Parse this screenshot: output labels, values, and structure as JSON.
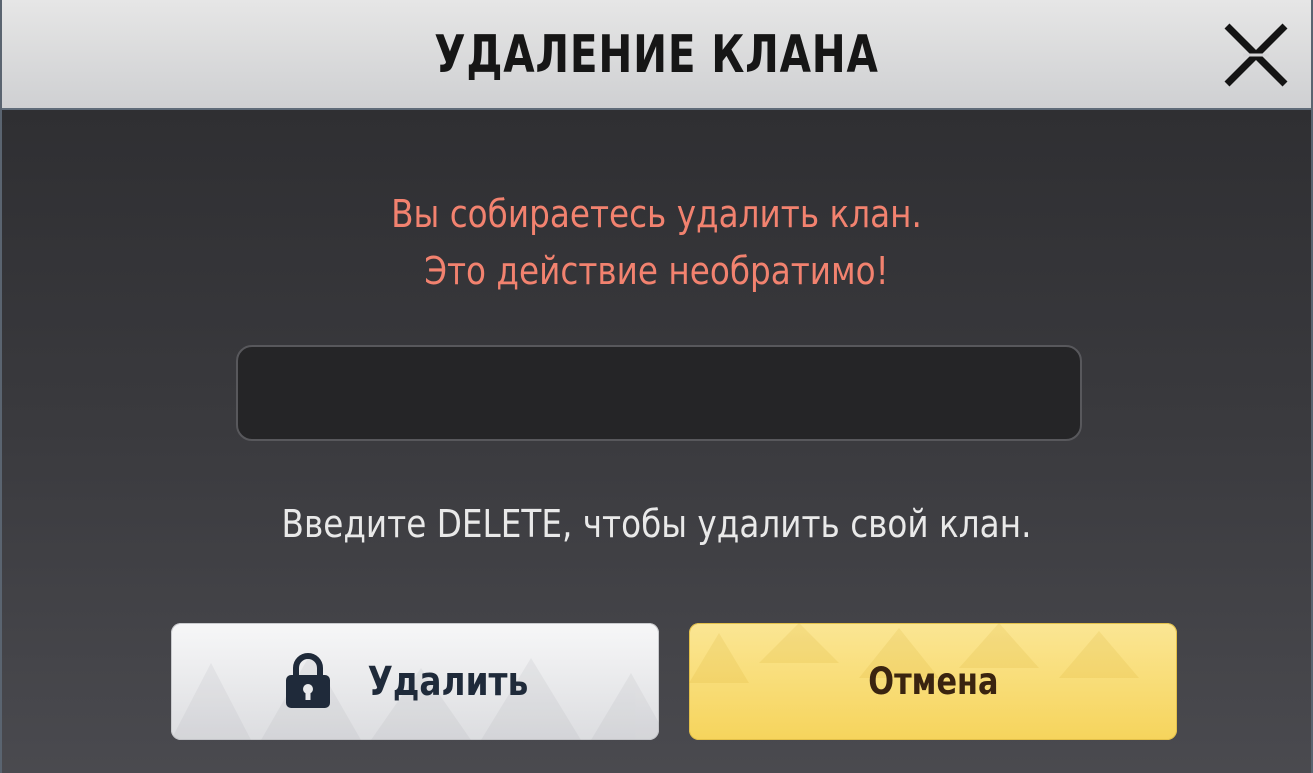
{
  "dialog": {
    "title": "УДАЛЕНИЕ КЛАНА",
    "close_icon": "close-icon",
    "warning_line1": "Вы собираетесь удалить клан.",
    "warning_line2": "Это действие необратимо!",
    "input": {
      "value": "",
      "placeholder": ""
    },
    "hint": "Введите DELETE, чтобы удалить свой клан.",
    "delete_button": {
      "label": "Удалить",
      "icon": "lock-icon"
    },
    "cancel_button": {
      "label": "Отмена"
    }
  },
  "colors": {
    "header_bg": "#d9d9db",
    "warning_text": "#f2826f",
    "cancel_bg": "#f6d45c",
    "delete_bg": "#e9eaec"
  }
}
